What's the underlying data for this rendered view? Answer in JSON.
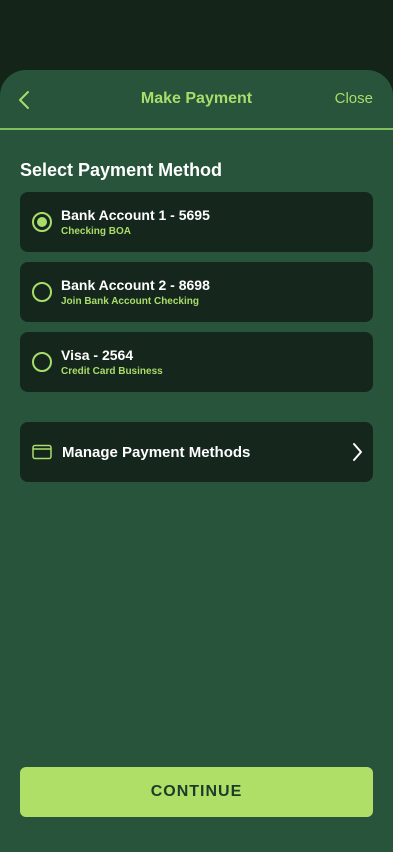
{
  "header": {
    "title": "Make Payment",
    "close_label": "Close"
  },
  "section_title": "Select Payment Method",
  "methods": [
    {
      "title": "Bank Account 1 - 5695",
      "subtitle": "Checking BOA",
      "selected": true
    },
    {
      "title": "Bank Account 2 - 8698",
      "subtitle": "Join Bank Account Checking",
      "selected": false
    },
    {
      "title": "Visa - 2564",
      "subtitle": "Credit Card Business",
      "selected": false
    }
  ],
  "manage": {
    "label": "Manage Payment Methods",
    "icon": "wallet-icon"
  },
  "continue_label": "CONTINUE",
  "colors": {
    "background": "#27543a",
    "card": "#15261c",
    "accent": "#a9dd6b",
    "button": "#afdf66"
  }
}
